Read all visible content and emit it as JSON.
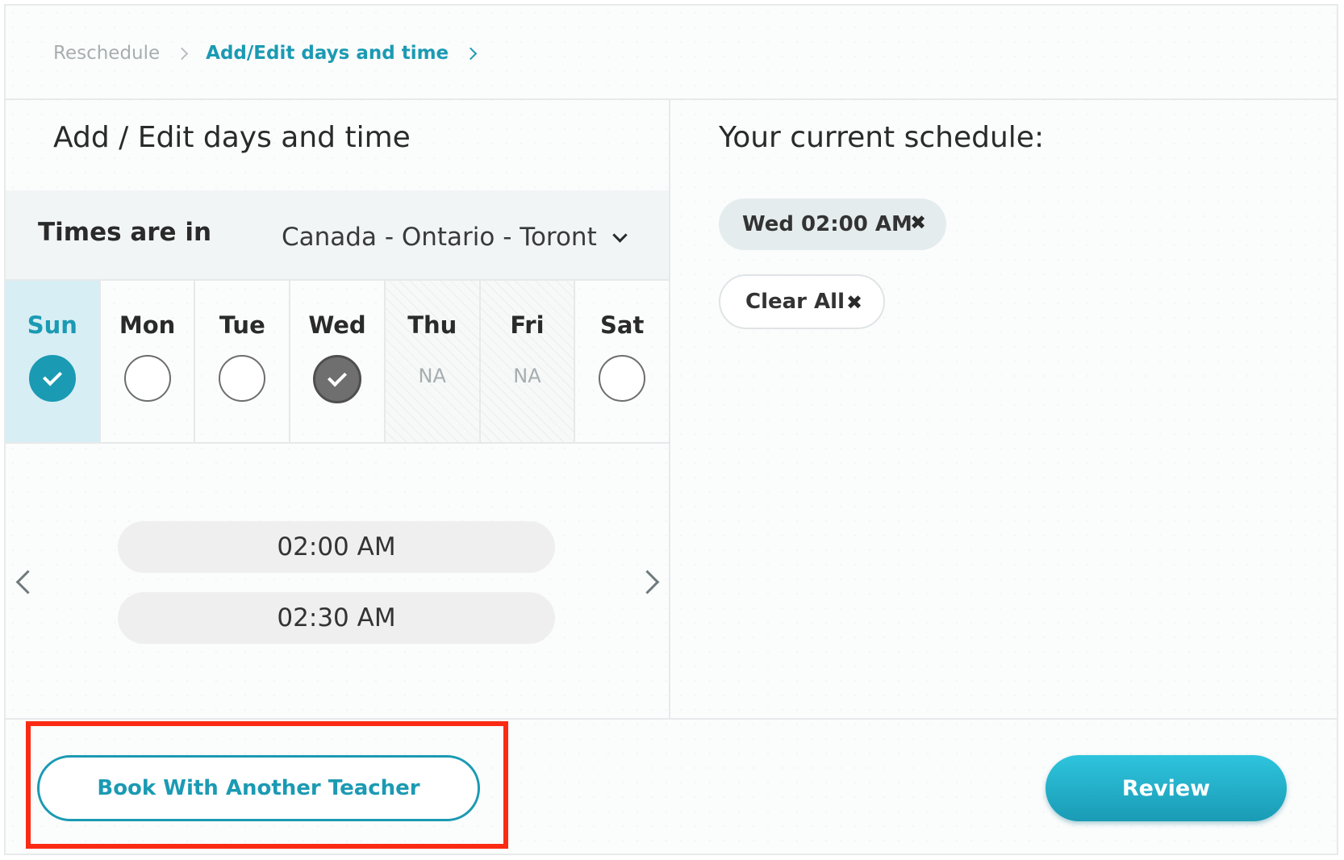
{
  "breadcrumb": {
    "items": [
      "Reschedule",
      "Add/Edit days and time"
    ]
  },
  "left_panel": {
    "title": "Add / Edit days and time",
    "timezone": {
      "label": "Times are in",
      "value": "Canada - Ontario - Toront"
    },
    "days": [
      {
        "label": "Sun",
        "state": "selected-active"
      },
      {
        "label": "Mon",
        "state": "empty"
      },
      {
        "label": "Tue",
        "state": "empty"
      },
      {
        "label": "Wed",
        "state": "checked"
      },
      {
        "label": "Thu",
        "state": "na",
        "na_text": "NA"
      },
      {
        "label": "Fri",
        "state": "na",
        "na_text": "NA"
      },
      {
        "label": "Sat",
        "state": "empty"
      }
    ],
    "time_slots": [
      "02:00 AM",
      "02:30 AM"
    ]
  },
  "right_panel": {
    "title": "Your current schedule:",
    "chips": [
      {
        "label": "Wed 02:00 AM",
        "remove_icon": "✖"
      }
    ],
    "clear_all": {
      "label": "Clear All",
      "icon": "✖"
    }
  },
  "footer": {
    "book_another_label": "Book With Another Teacher",
    "review_label": "Review"
  },
  "colors": {
    "accent": "#1b9ab3",
    "active_day_bg": "#d7eef4",
    "highlight_border": "#fb2a14"
  }
}
